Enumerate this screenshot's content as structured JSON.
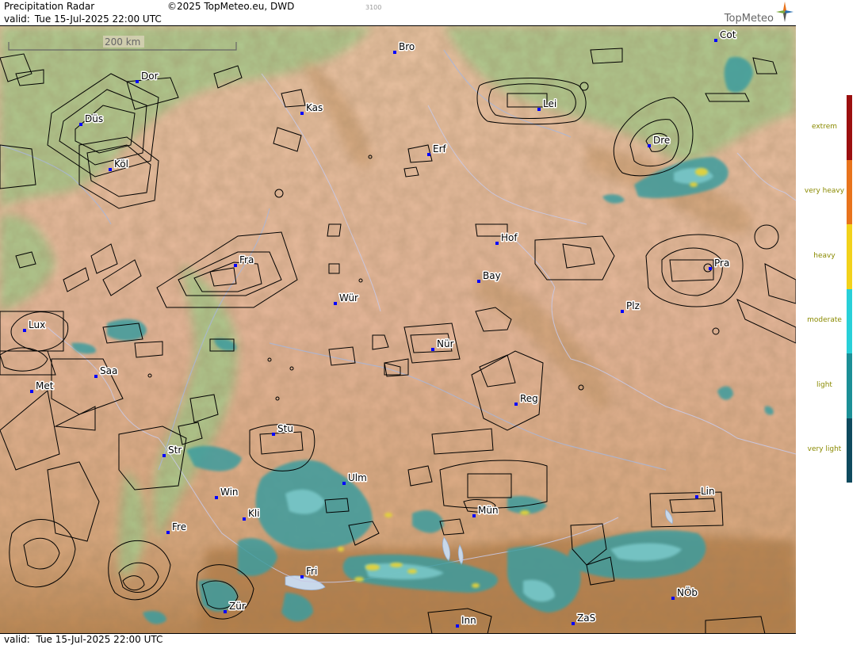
{
  "header": {
    "title": "Precipitation Radar",
    "copyright": "©2025 TopMeteo.eu, DWD",
    "valid_label": "valid:",
    "valid_time": "Tue  15-Jul-2025 22:00 UTC",
    "stamp": "3100",
    "brand": "TopMeteo"
  },
  "footer": {
    "valid_label": "valid:",
    "valid_time": "Tue  15-Jul-2025 22:00 UTC"
  },
  "scale_bar": {
    "label": "200 km"
  },
  "cities": [
    {
      "id": "mun-top",
      "label": "Mün"
    },
    {
      "id": "bro",
      "label": "Bro"
    },
    {
      "id": "cot",
      "label": "Cot"
    },
    {
      "id": "dor",
      "label": "Dor"
    },
    {
      "id": "kas",
      "label": "Kas"
    },
    {
      "id": "lei",
      "label": "Lei"
    },
    {
      "id": "dus",
      "label": "Düs"
    },
    {
      "id": "erf",
      "label": "Erf"
    },
    {
      "id": "dre",
      "label": "Dre"
    },
    {
      "id": "kol",
      "label": "Köl"
    },
    {
      "id": "hof",
      "label": "Hof"
    },
    {
      "id": "fra",
      "label": "Fra"
    },
    {
      "id": "pra",
      "label": "Pra"
    },
    {
      "id": "bay",
      "label": "Bay"
    },
    {
      "id": "wur",
      "label": "Wür"
    },
    {
      "id": "plz",
      "label": "Plz"
    },
    {
      "id": "lux",
      "label": "Lux"
    },
    {
      "id": "nur",
      "label": "Nür"
    },
    {
      "id": "saa",
      "label": "Saa"
    },
    {
      "id": "met",
      "label": "Met"
    },
    {
      "id": "reg",
      "label": "Reg"
    },
    {
      "id": "stu",
      "label": "Stu"
    },
    {
      "id": "str",
      "label": "Str"
    },
    {
      "id": "ulm",
      "label": "Ulm"
    },
    {
      "id": "win",
      "label": "Win"
    },
    {
      "id": "lin",
      "label": "Lin"
    },
    {
      "id": "kli",
      "label": "Kli"
    },
    {
      "id": "mun",
      "label": "Mün"
    },
    {
      "id": "fre",
      "label": "Fre"
    },
    {
      "id": "fri",
      "label": "Fri"
    },
    {
      "id": "nob",
      "label": "NÖb"
    },
    {
      "id": "zur",
      "label": "Zür"
    },
    {
      "id": "zas",
      "label": "ZaS"
    },
    {
      "id": "inn",
      "label": "Inn"
    }
  ],
  "legend": {
    "items": [
      {
        "label": "extrem",
        "color": "#9b0f0f"
      },
      {
        "label": "very heavy",
        "color": "#e8731c"
      },
      {
        "label": "heavy",
        "color": "#f2d21b"
      },
      {
        "label": "moderate",
        "color": "#28d0d8"
      },
      {
        "label": "light",
        "color": "#1c8f96"
      },
      {
        "label": "very light",
        "color": "#0f4a5e"
      }
    ]
  },
  "colors": {
    "terrain_low": "#e7b79c",
    "terrain_green": "#a7c98a",
    "rain_light": "#3e9c9e",
    "rain_moderate": "#6cc2c6",
    "rain_heavy": "#e3d23a",
    "city_dot": "#0000ff"
  }
}
